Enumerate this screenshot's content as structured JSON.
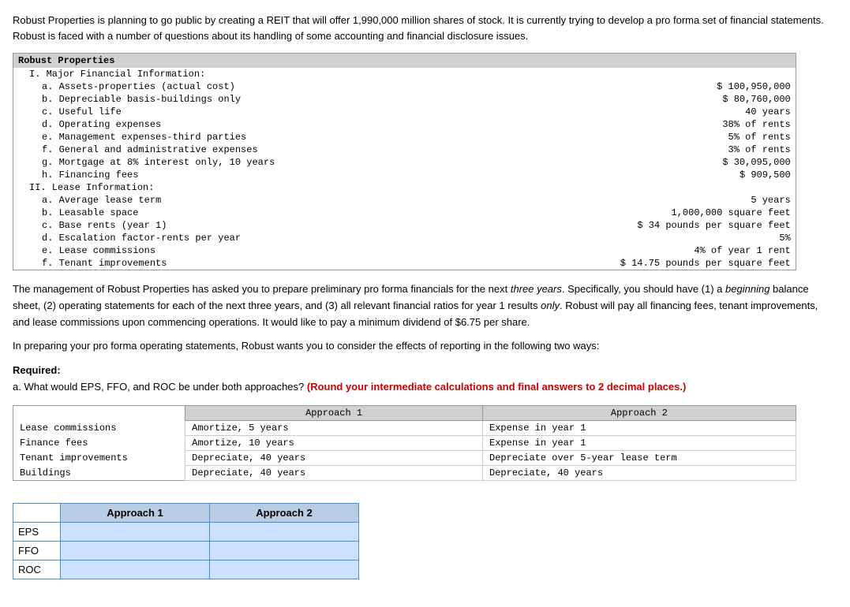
{
  "intro": {
    "text": "Robust Properties is planning to go public by creating a REIT that will offer 1,990,000 million shares of stock. It is currently trying to develop a pro forma set of financial statements. Robust is faced with a number of questions about its handling of some accounting and financial disclosure issues."
  },
  "financialTable": {
    "title": "Robust Properties",
    "sections": [
      {
        "label": "I. Major Financial Information:",
        "items": [
          {
            "label": "a. Assets-properties (actual cost)",
            "value": "$ 100,950,000"
          },
          {
            "label": "b. Depreciable basis-buildings only",
            "value": "$ 80,760,000"
          },
          {
            "label": "c. Useful life",
            "value": "40 years"
          },
          {
            "label": "d. Operating expenses",
            "value": "38% of rents"
          },
          {
            "label": "e. Management expenses-third parties",
            "value": "5% of rents"
          },
          {
            "label": "f. General and administrative expenses",
            "value": "3% of rents"
          },
          {
            "label": "g. Mortgage at 8% interest only, 10 years",
            "value": "$ 30,095,000"
          },
          {
            "label": "h. Financing fees",
            "value": "$ 909,500"
          }
        ]
      },
      {
        "label": "II. Lease Information:",
        "items": [
          {
            "label": "a. Average lease term",
            "value": "5 years"
          },
          {
            "label": "b. Leasable space",
            "value": "1,000,000 square feet"
          },
          {
            "label": "c. Base rents (year 1)",
            "value": "$ 34 pounds per square feet"
          },
          {
            "label": "d. Escalation factor-rents per year",
            "value": "5%"
          },
          {
            "label": "e. Lease commissions",
            "value": "4% of year 1 rent"
          },
          {
            "label": "f. Tenant improvements",
            "value": "$ 14.75 pounds per square feet"
          }
        ]
      }
    ]
  },
  "middleText1": "The management of Robust Properties has asked you to prepare preliminary pro forma financials for the next three years. Specifically, you should have (1) a beginning balance sheet, (2) operating statements for each of the next three years, and (3) all relevant financial ratios for year 1 results only. Robust will pay all financing fees, tenant improvements, and lease commissions upon commencing operations. It would like to pay a minimum dividend of $6.75 per share.",
  "middleText2": "In preparing your pro forma operating statements, Robust wants you to consider the effects of reporting in the following two ways:",
  "required": {
    "label": "Required:",
    "partA": "a. What would EPS, FFO, and ROC be under both approaches?",
    "boldPart": "(Round your intermediate calculations and final answers to 2 decimal places.)"
  },
  "approachTable": {
    "headers": [
      "",
      "Approach 1",
      "Approach 2"
    ],
    "rows": [
      {
        "label": "Lease commissions",
        "approach1": "Amortize, 5 years",
        "approach2": "Expense in year 1"
      },
      {
        "label": "Finance fees",
        "approach1": "Amortize, 10 years",
        "approach2": "Expense in year 1"
      },
      {
        "label": "Tenant improvements",
        "approach1": "Depreciate, 40 years",
        "approach2": "Depreciate over 5-year lease term"
      },
      {
        "label": "Buildings",
        "approach1": "Depreciate, 40 years",
        "approach2": "Depreciate, 40 years"
      }
    ]
  },
  "inputGrid": {
    "headers": [
      "",
      "Approach 1",
      "Approach 2"
    ],
    "rows": [
      {
        "label": "EPS"
      },
      {
        "label": "FFO"
      },
      {
        "label": "ROC"
      }
    ]
  }
}
